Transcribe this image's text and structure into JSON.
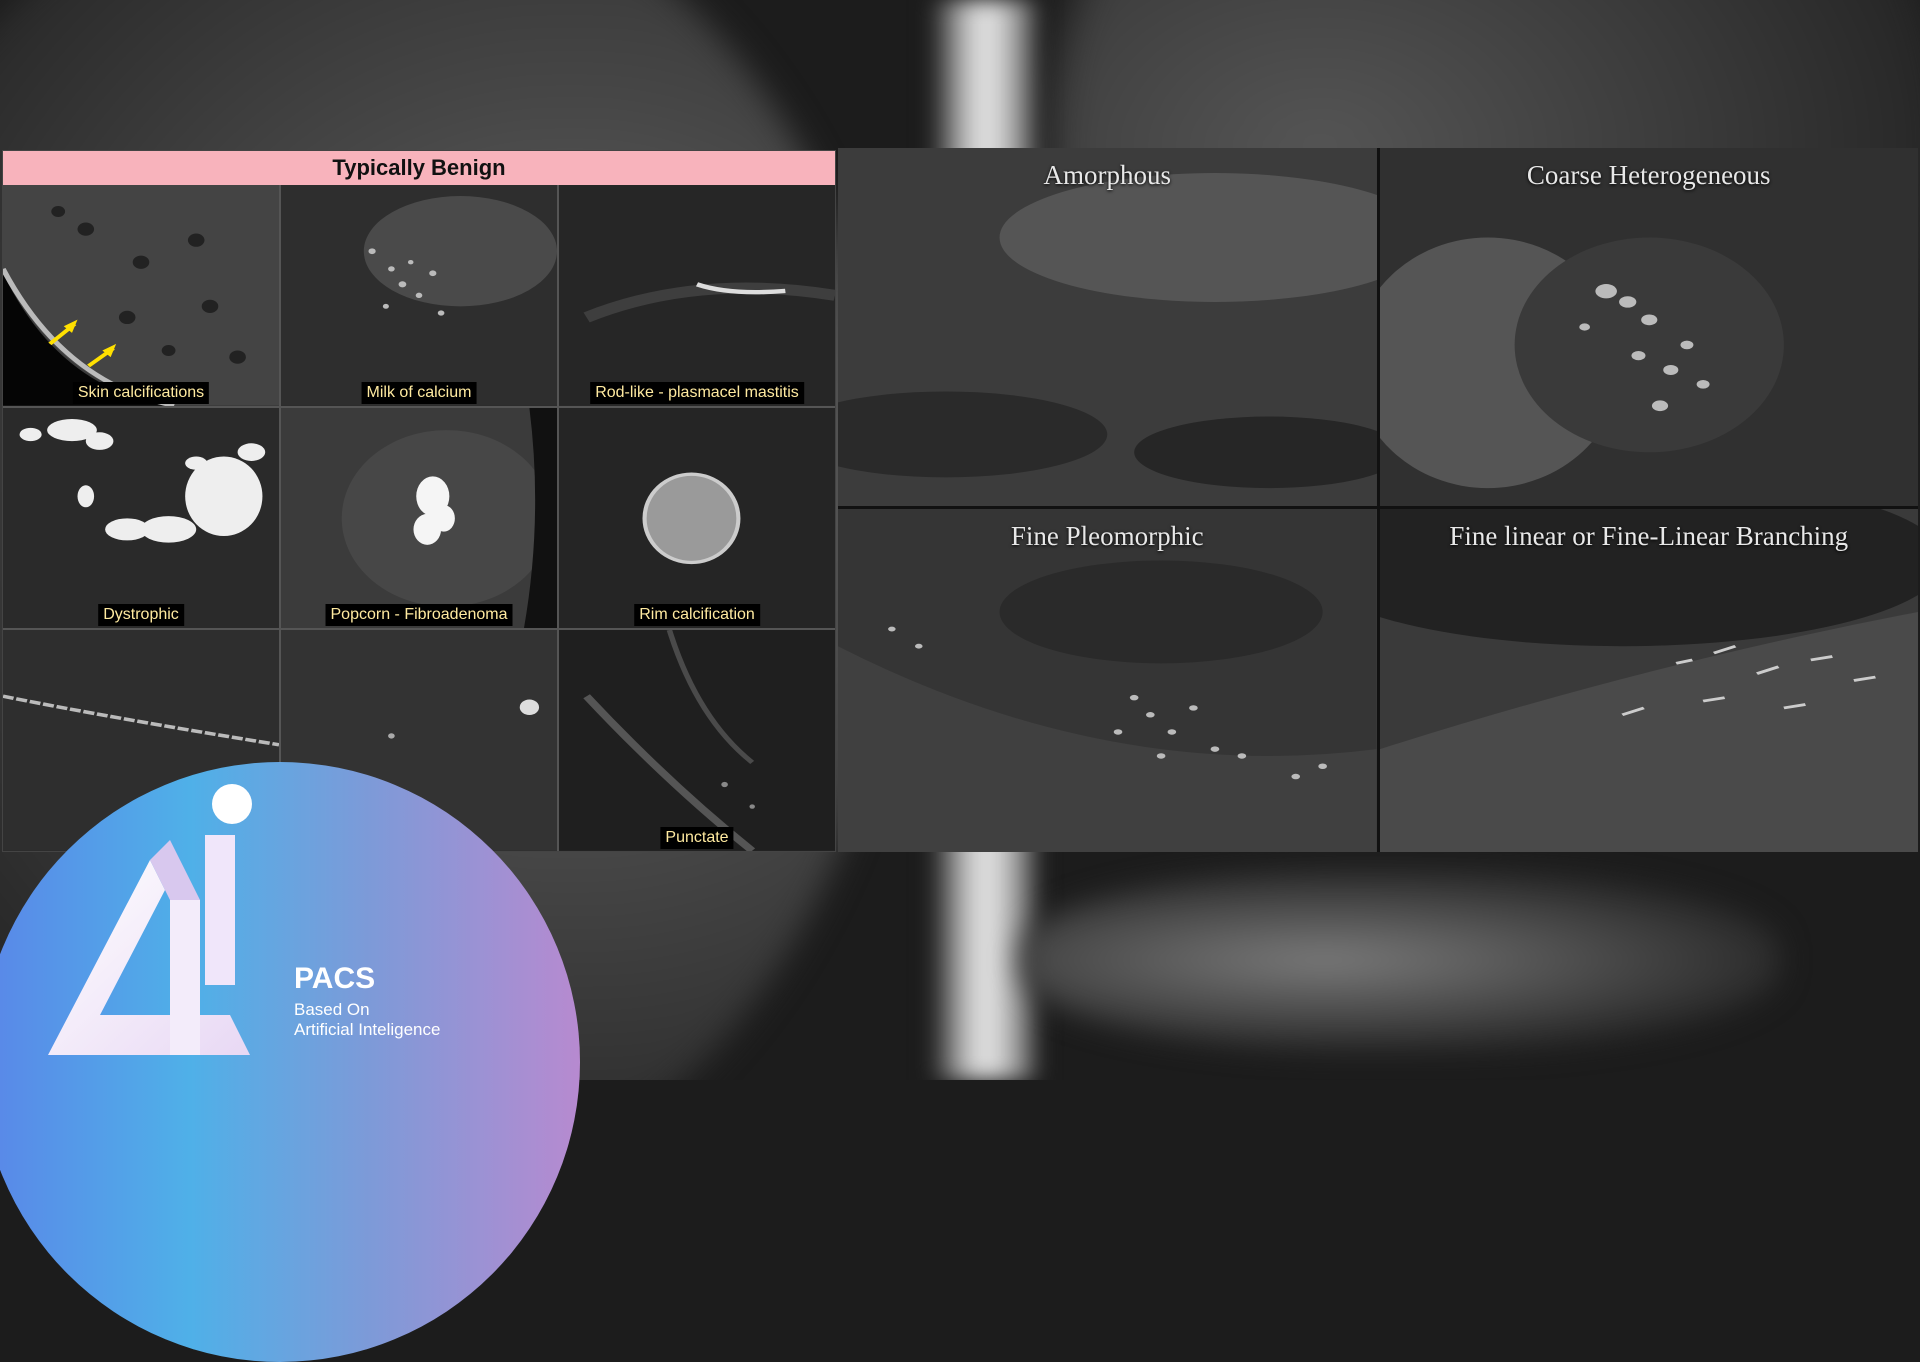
{
  "benign_panel": {
    "header": "Typically Benign",
    "cells": [
      {
        "label": "Skin calcifications"
      },
      {
        "label": "Milk of calcium"
      },
      {
        "label": "Rod-like - plasmacel mastitis"
      },
      {
        "label": "Dystrophic"
      },
      {
        "label": "Popcorn - Fibroadenoma"
      },
      {
        "label": "Rim calcification"
      },
      {
        "label": ""
      },
      {
        "label": ""
      },
      {
        "label": "Punctate"
      }
    ]
  },
  "suspicious_panels": [
    {
      "title": "Amorphous"
    },
    {
      "title": "Coarse Heterogeneous"
    },
    {
      "title": "Fine Pleomorphic"
    },
    {
      "title": "Fine linear or Fine-Linear Branching"
    }
  ],
  "logo": {
    "name": "PACS",
    "tagline_line1": "Based On",
    "tagline_line2": "Artificial Inteligence",
    "colors": {
      "gradient_start": "#5a86e8",
      "gradient_mid": "#4fb0e8",
      "gradient_end": "#b78ad0"
    }
  },
  "colors": {
    "benign_header_bg": "#f8b3bc",
    "label_text": "#ffeaa0"
  }
}
